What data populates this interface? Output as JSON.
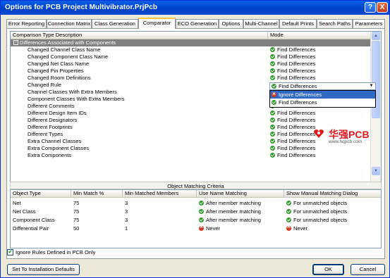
{
  "window": {
    "title": "Options for PCB Project Multivibrator.PrjPcb"
  },
  "title_buttons": {
    "help": "?",
    "close": "X"
  },
  "tabs": [
    {
      "label": "Error Reporting",
      "active": false
    },
    {
      "label": "Connection Matrix",
      "active": false
    },
    {
      "label": "Class Generation",
      "active": false
    },
    {
      "label": "Comparator",
      "active": true
    },
    {
      "label": "ECO Generation",
      "active": false
    },
    {
      "label": "Options",
      "active": false
    },
    {
      "label": "Multi-Channel",
      "active": false
    },
    {
      "label": "Default Prints",
      "active": false
    },
    {
      "label": "Search Paths",
      "active": false
    },
    {
      "label": "Parameters",
      "active": false
    }
  ],
  "comparison": {
    "headers": {
      "description": "Comparison Type Description",
      "mode": "Mode"
    },
    "group": {
      "toggle": "−",
      "label": "Differences Associated with Components"
    },
    "rows": [
      {
        "label": "Changed Channel Class Name",
        "mode": "Find Differences",
        "icon": "check-icon"
      },
      {
        "label": "Changed Component Class Name",
        "mode": "Find Differences",
        "icon": "check-icon"
      },
      {
        "label": "Changed Net Class Name",
        "mode": "Find Differences",
        "icon": "check-icon"
      },
      {
        "label": "Changed Pin Properties",
        "mode": "Find Differences",
        "icon": "check-icon"
      },
      {
        "label": "Changed Room Definitions",
        "mode": "Find Differences",
        "icon": "check-icon"
      },
      {
        "label": "Changed Rule",
        "mode": "",
        "icon": ""
      },
      {
        "label": "Channel Classes With Extra Members",
        "mode": "",
        "icon": ""
      },
      {
        "label": "Component Classes With Extra Members",
        "mode": "",
        "icon": ""
      },
      {
        "label": "Different Comments",
        "mode": "Find Differences",
        "icon": "check-icon"
      },
      {
        "label": "Different Design Item IDs",
        "mode": "Find Differences",
        "icon": "check-icon"
      },
      {
        "label": "Different Designators",
        "mode": "Find Differences",
        "icon": "check-icon"
      },
      {
        "label": "Different Footprints",
        "mode": "Find Differences",
        "icon": "check-icon"
      },
      {
        "label": "Different Types",
        "mode": "Find Differences",
        "icon": "check-icon"
      },
      {
        "label": "Extra Channel Classes",
        "mode": "Find Differences",
        "icon": "check-icon"
      },
      {
        "label": "Extra Component Classes",
        "mode": "Find Differences",
        "icon": "check-icon"
      },
      {
        "label": "Extra Components",
        "mode": "Find Differences",
        "icon": "check-icon"
      }
    ],
    "dropdown": {
      "value": "Find Differences",
      "options": [
        {
          "label": "Ignore Differences",
          "selected": true
        },
        {
          "label": "Find Differences",
          "selected": false
        }
      ]
    }
  },
  "object_matching": {
    "title": "Object Matching Criteria",
    "headers": {
      "type": "Object Type",
      "min_match": "Min Match %",
      "min_members": "Min Matched Members",
      "use_name": "Use Name Matching",
      "show_manual": "Show Manual Matching Dialog"
    },
    "rows": [
      {
        "type": "Net",
        "min_match": "75",
        "min_members": "3",
        "use_name": "After member matching",
        "use_name_icon": "check-icon",
        "show_manual": "For unmatched objects",
        "show_manual_icon": "check-icon"
      },
      {
        "type": "Net Class",
        "min_match": "75",
        "min_members": "3",
        "use_name": "After member matching",
        "use_name_icon": "check-icon",
        "show_manual": "For unmatched objects",
        "show_manual_icon": "check-icon"
      },
      {
        "type": "Component Class",
        "min_match": "75",
        "min_members": "3",
        "use_name": "After member matching",
        "use_name_icon": "check-icon",
        "show_manual": "For unmatched objects",
        "show_manual_icon": "check-icon"
      },
      {
        "type": "Differential Pair",
        "min_match": "50",
        "min_members": "1",
        "use_name": "Never",
        "use_name_icon": "cross-icon",
        "show_manual": "Never",
        "show_manual_icon": "cross-icon"
      }
    ]
  },
  "ignore_rules": {
    "label": "Ignore Rules Defined in PCB Only",
    "checked": true
  },
  "buttons": {
    "defaults": "Set To Installation Defaults",
    "ok": "OK",
    "cancel": "Cancel"
  },
  "watermark": {
    "brand": "华强PCB",
    "url": "www.hqpcb.com"
  }
}
